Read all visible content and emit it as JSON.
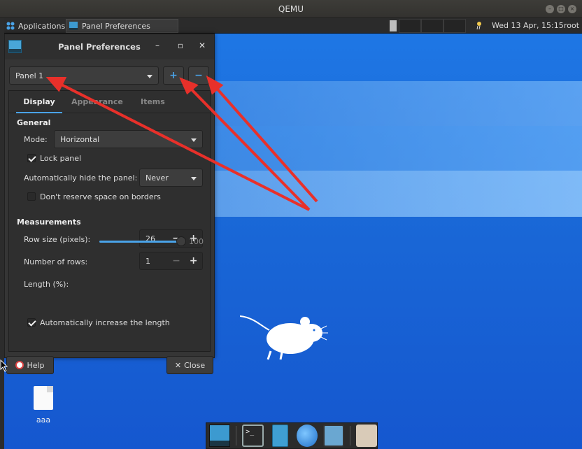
{
  "host_window": {
    "title": "QEMU"
  },
  "top_panel": {
    "apps_label": "Applications",
    "task_label": "Panel Preferences",
    "clock": "Wed 13 Apr, 15:15",
    "user": "root"
  },
  "dialog": {
    "title": "Panel Preferences",
    "panel_selected": "Panel 1",
    "add_symbol": "+",
    "remove_symbol": "−",
    "tabs": [
      "Display",
      "Appearance",
      "Items"
    ],
    "general_header": "General",
    "mode_label": "Mode:",
    "mode_value": "Horizontal",
    "lock_panel_label": "Lock panel",
    "lock_panel_checked": true,
    "autohide_label": "Automatically hide the panel:",
    "autohide_value": "Never",
    "reserve_label": "Don't reserve space on borders",
    "reserve_checked": false,
    "measurements_header": "Measurements",
    "row_size_label": "Row size (pixels):",
    "row_size_value": "26",
    "rows_label": "Number of rows:",
    "rows_value": "1",
    "length_label": "Length (%):",
    "length_value": "100",
    "auto_increase_label": "Automatically increase the length",
    "auto_increase_checked": true,
    "help_label": "Help",
    "close_label": "Close",
    "spin_minus": "−",
    "spin_plus": "+"
  },
  "desktop": {
    "file_label": "aaa"
  },
  "dock": {
    "terminal_glyph": ">_"
  },
  "colors": {
    "accent": "#4aa3e8",
    "annotation_arrow": "#e8302a",
    "desktop": "#1a6ad8"
  }
}
